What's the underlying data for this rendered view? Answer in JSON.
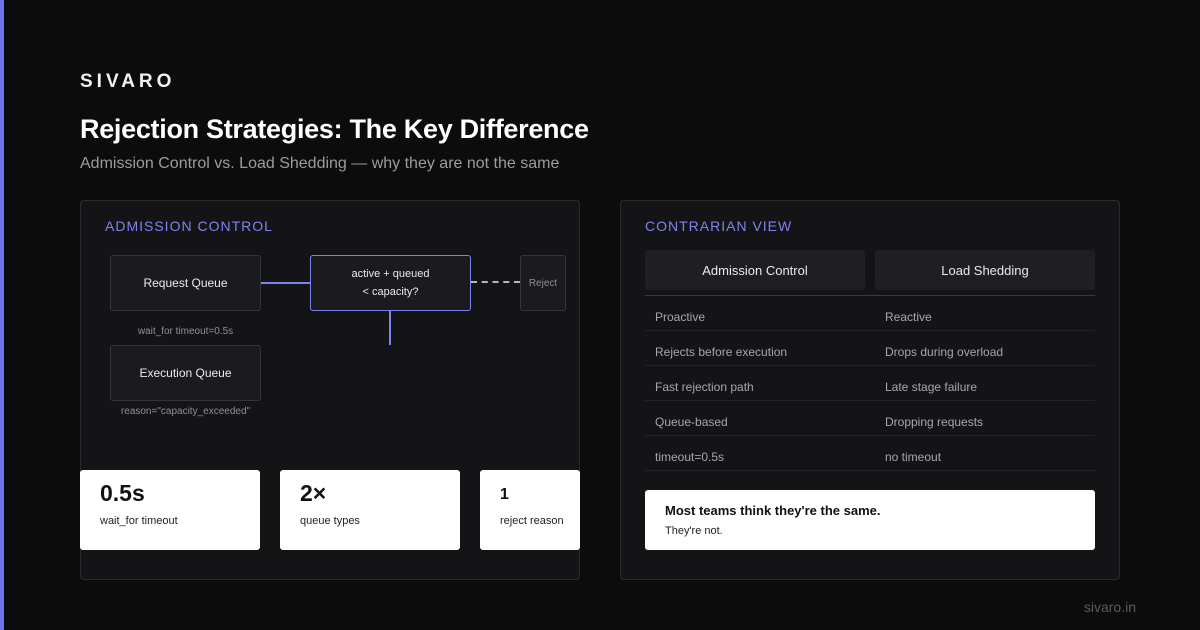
{
  "brand": "SIVARO",
  "title": "Rejection Strategies: The Key Difference",
  "subtitle": "Admission Control vs. Load Shedding — why they are not the same",
  "footer": "sivaro.in",
  "accent_color": "#6b74e8",
  "left_panel": {
    "label": "ADMISSION CONTROL",
    "diagram": {
      "request_queue": "Request Queue",
      "request_caption": "wait_for timeout=0.5s",
      "execution_queue": "Execution Queue",
      "execution_caption": "reason=\"capacity_exceeded\"",
      "decision_line1": "active + queued",
      "decision_line2": "< capacity?",
      "reject": "Reject"
    },
    "stats": [
      {
        "value": "0.5s",
        "label": "wait_for timeout"
      },
      {
        "value": "2×",
        "label": "queue types"
      },
      {
        "value": "1",
        "label": "reject reason"
      }
    ]
  },
  "right_panel": {
    "label": "CONTRARIAN VIEW",
    "columns": [
      "Admission Control",
      "Load Shedding"
    ],
    "rows": [
      [
        "Proactive",
        "Reactive"
      ],
      [
        "Rejects before execution",
        "Drops during overload"
      ],
      [
        "Fast rejection path",
        "Late stage failure"
      ],
      [
        "Queue-based",
        "Dropping requests"
      ],
      [
        "timeout=0.5s",
        "no timeout"
      ]
    ],
    "callout": {
      "main": "Most teams think they're the same.",
      "sub": "They're not."
    }
  }
}
